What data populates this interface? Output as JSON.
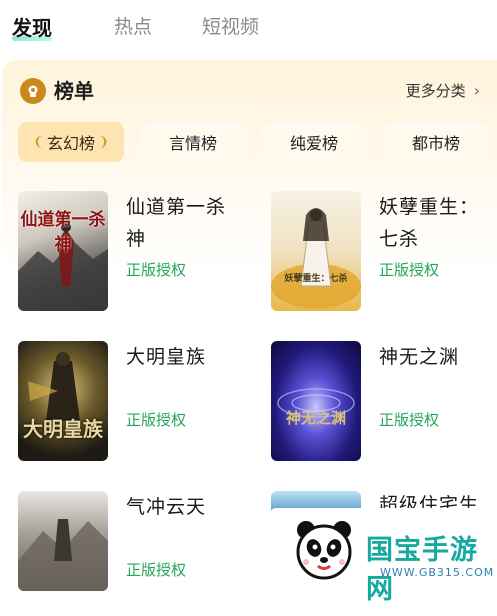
{
  "tabs": [
    {
      "label": "发现",
      "active": true
    },
    {
      "label": "热点",
      "active": false
    },
    {
      "label": "短视频",
      "active": false
    }
  ],
  "ranking": {
    "icon": "crown-icon",
    "title": "榜单",
    "more_label": "更多分类",
    "more_icon": "chevron-right-icon"
  },
  "categories": [
    {
      "label": "玄幻榜",
      "active": true
    },
    {
      "label": "言情榜",
      "active": false
    },
    {
      "label": "纯爱榜",
      "active": false
    },
    {
      "label": "都市榜",
      "active": false
    }
  ],
  "books": [
    {
      "title": "仙道第一杀神",
      "tag": "正版授权",
      "cover_text": "仙道第一杀神"
    },
    {
      "title": "妖孽重生：七杀",
      "tag": "正版授权",
      "cover_text": "妖孽重生：七杀"
    },
    {
      "title": "大明皇族",
      "tag": "正版授权",
      "cover_text": "大明皇族"
    },
    {
      "title": "神无之渊",
      "tag": "正版授权",
      "cover_text": "神无之渊"
    },
    {
      "title": "气冲云天",
      "tag": "正版授权",
      "cover_text": ""
    },
    {
      "title": "超级住宅生",
      "tag": "",
      "cover_text": ""
    }
  ],
  "watermark": {
    "title": "国宝手游网",
    "url": "WWW.GB315.COM"
  },
  "colors": {
    "accent_green": "#23a55a",
    "chip_active_bg": "#fde4b0",
    "crown": "#c98a1b",
    "watermark": "#16a9a0"
  }
}
